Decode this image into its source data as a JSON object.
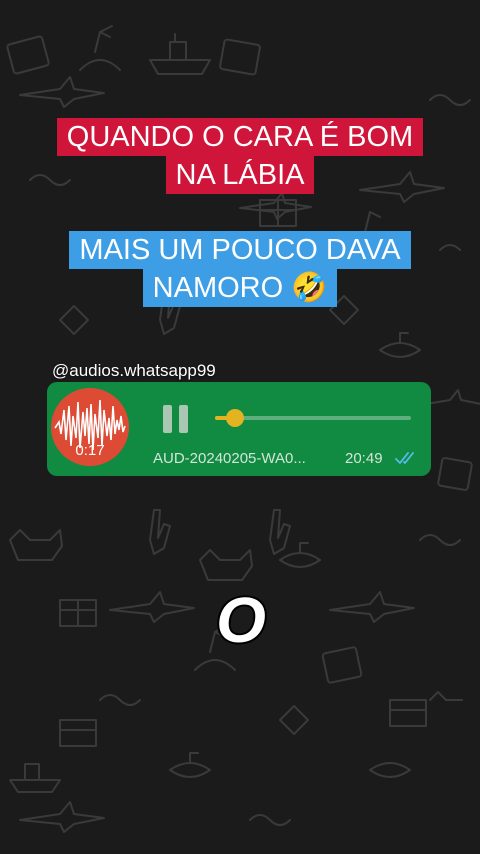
{
  "captions": {
    "line1": "QUANDO O CARA É BOM",
    "line2": "NA LÁBIA",
    "line3": "MAIS UM POUCO DAVA",
    "line4": "NAMORO 🤣"
  },
  "watermark": {
    "handle": "@audios.whatsapp99"
  },
  "voice_message": {
    "duration": "0:17",
    "filename": "AUD-20240205-WA0...",
    "time": "20:49",
    "progress": 0.1,
    "read_status": "read-double-check"
  },
  "overlay_text": "O",
  "colors": {
    "background": "#1b1b1b",
    "caption_red": "#d0153a",
    "caption_blue": "#3d9ee6",
    "bubble": "#118a42",
    "accent": "#e3b321",
    "read_ticks": "#53bdeb"
  }
}
